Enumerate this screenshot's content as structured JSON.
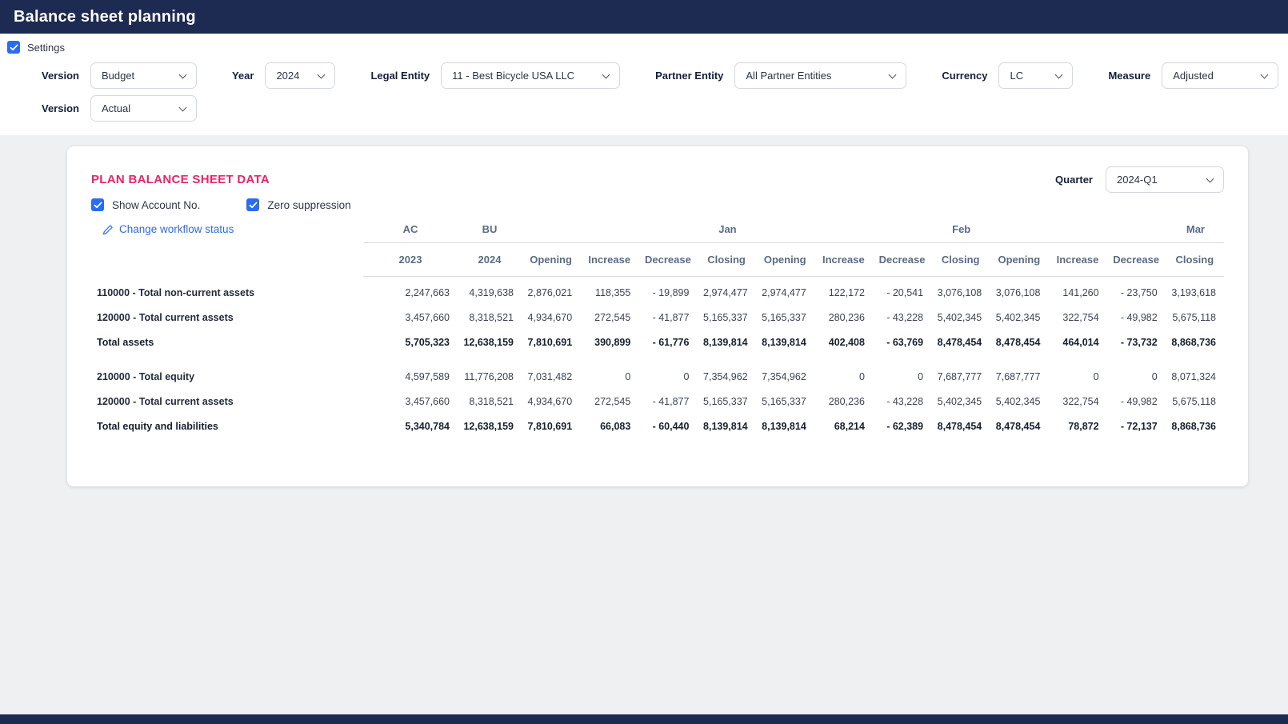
{
  "header": {
    "title": "Balance sheet planning"
  },
  "settings": {
    "label": "Settings",
    "checked": true
  },
  "filters": {
    "row1": [
      {
        "label": "Version",
        "value": "Budget"
      },
      {
        "label": "Year",
        "value": "2024"
      },
      {
        "label": "Legal Entity",
        "value": "11 - Best Bicycle USA LLC"
      },
      {
        "label": "Partner Entity",
        "value": "All Partner Entities"
      },
      {
        "label": "Currency",
        "value": "LC"
      },
      {
        "label": "Measure",
        "value": "Adjusted"
      }
    ],
    "row2": [
      {
        "label": "Version",
        "value": "Actual"
      }
    ]
  },
  "card": {
    "title": "PLAN BALANCE SHEET DATA",
    "quarter": {
      "label": "Quarter",
      "value": "2024-Q1"
    },
    "checkboxes": [
      {
        "label": "Show Account No.",
        "checked": true
      },
      {
        "label": "Zero suppression",
        "checked": true
      }
    ],
    "workflow_link": {
      "label": "Change workflow status",
      "icon": "pencil-icon"
    },
    "table": {
      "group_headers": [
        {
          "label": "AC",
          "span": 1,
          "align": "center"
        },
        {
          "label": "BU",
          "span": 1,
          "align": "center"
        },
        {
          "label": "Jan",
          "span": 4,
          "align": "right"
        },
        {
          "label": "Feb",
          "span": 4,
          "align": "right"
        },
        {
          "label": "Mar",
          "span": 4,
          "align": "right"
        }
      ],
      "sub_headers": [
        "2023",
        "2024",
        "Opening",
        "Increase",
        "Decrease",
        "Closing",
        "Opening",
        "Increase",
        "Decrease",
        "Closing",
        "Opening",
        "Increase",
        "Decrease",
        "Closing"
      ],
      "rows": [
        {
          "label": "110000 - Total non-current assets",
          "bold": false,
          "spacer": false,
          "values": [
            "2,247,663",
            "4,319,638",
            "2,876,021",
            "118,355",
            "- 19,899",
            "2,974,477",
            "2,974,477",
            "122,172",
            "- 20,541",
            "3,076,108",
            "3,076,108",
            "141,260",
            "- 23,750",
            "3,193,618"
          ]
        },
        {
          "label": "120000 - Total current assets",
          "bold": false,
          "spacer": false,
          "values": [
            "3,457,660",
            "8,318,521",
            "4,934,670",
            "272,545",
            "- 41,877",
            "5,165,337",
            "5,165,337",
            "280,236",
            "- 43,228",
            "5,402,345",
            "5,402,345",
            "322,754",
            "- 49,982",
            "5,675,118"
          ]
        },
        {
          "label": "Total assets",
          "bold": true,
          "spacer": false,
          "values": [
            "5,705,323",
            "12,638,159",
            "7,810,691",
            "390,899",
            "- 61,776",
            "8,139,814",
            "8,139,814",
            "402,408",
            "- 63,769",
            "8,478,454",
            "8,478,454",
            "464,014",
            "- 73,732",
            "8,868,736"
          ]
        },
        {
          "label": "",
          "bold": false,
          "spacer": true,
          "values": []
        },
        {
          "label": "210000 - Total equity",
          "bold": false,
          "spacer": false,
          "values": [
            "4,597,589",
            "11,776,208",
            "7,031,482",
            "0",
            "0",
            "7,354,962",
            "7,354,962",
            "0",
            "0",
            "7,687,777",
            "7,687,777",
            "0",
            "0",
            "8,071,324"
          ]
        },
        {
          "label": "120000 - Total current assets",
          "bold": false,
          "spacer": false,
          "values": [
            "3,457,660",
            "8,318,521",
            "4,934,670",
            "272,545",
            "- 41,877",
            "5,165,337",
            "5,165,337",
            "280,236",
            "- 43,228",
            "5,402,345",
            "5,402,345",
            "322,754",
            "- 49,982",
            "5,675,118"
          ]
        },
        {
          "label": "Total equity and liabilities",
          "bold": true,
          "spacer": false,
          "values": [
            "5,340,784",
            "12,638,159",
            "7,810,691",
            "66,083",
            "- 60,440",
            "8,139,814",
            "8,139,814",
            "68,214",
            "- 62,389",
            "8,478,454",
            "8,478,454",
            "78,872",
            "- 72,137",
            "8,868,736"
          ]
        }
      ]
    }
  },
  "colors": {
    "navy": "#1d2a52",
    "pink_title": "#e9246b",
    "checkbox_blue": "#2b6cf0",
    "link_blue": "#2e6be6",
    "table_header_text": "#5b6b84"
  }
}
